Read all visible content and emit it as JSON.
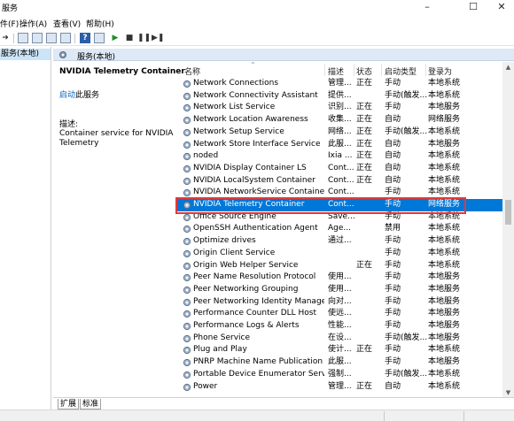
{
  "window": {
    "title": "服务"
  },
  "menu": [
    "件(F)",
    "操作(A)",
    "查看(V)",
    "帮助(H)"
  ],
  "tree": {
    "selected": "服务(本地)"
  },
  "band": {
    "label": "服务(本地)"
  },
  "details": {
    "service_name": "NVIDIA Telemetry Container",
    "start_link": "启动",
    "start_suffix": "此服务",
    "desc_label": "描述:",
    "desc_text": "Container service for NVIDIA Telemetry"
  },
  "columns": {
    "name": "名称",
    "desc": "描述",
    "status": "状态",
    "start": "启动类型",
    "logon": "登录为"
  },
  "rows": [
    {
      "name": "Network Connections",
      "desc": "管理...",
      "status": "正在",
      "start": "手动",
      "logon": "本地系统"
    },
    {
      "name": "Network Connectivity Assistant",
      "desc": "提供...",
      "status": "",
      "start": "手动(触发...",
      "logon": "本地系统"
    },
    {
      "name": "Network List Service",
      "desc": "识别...",
      "status": "正在",
      "start": "手动",
      "logon": "本地服务"
    },
    {
      "name": "Network Location Awareness",
      "desc": "收集...",
      "status": "正在",
      "start": "自动",
      "logon": "网络服务"
    },
    {
      "name": "Network Setup Service",
      "desc": "网络...",
      "status": "正在",
      "start": "手动(触发...",
      "logon": "本地系统"
    },
    {
      "name": "Network Store Interface Service",
      "desc": "此服...",
      "status": "正在",
      "start": "自动",
      "logon": "本地服务"
    },
    {
      "name": "noded",
      "desc": "Ixia ...",
      "status": "正在",
      "start": "自动",
      "logon": "本地系统"
    },
    {
      "name": "NVIDIA Display Container LS",
      "desc": "Cont...",
      "status": "正在",
      "start": "自动",
      "logon": "本地系统"
    },
    {
      "name": "NVIDIA LocalSystem Container",
      "desc": "Cont...",
      "status": "正在",
      "start": "自动",
      "logon": "本地系统"
    },
    {
      "name": "NVIDIA NetworkService Container",
      "desc": "Cont...",
      "status": "",
      "start": "手动",
      "logon": "本地系统"
    },
    {
      "name": "NVIDIA Telemetry Container",
      "desc": "Cont...",
      "status": "",
      "start": "手动",
      "logon": "网络服务"
    },
    {
      "name": "Office  Source Engine",
      "desc": "Save...",
      "status": "",
      "start": "手动",
      "logon": "本地系统"
    },
    {
      "name": "OpenSSH Authentication Agent",
      "desc": "Age...",
      "status": "",
      "start": "禁用",
      "logon": "本地系统"
    },
    {
      "name": "Optimize drives",
      "desc": "通过...",
      "status": "",
      "start": "手动",
      "logon": "本地系统"
    },
    {
      "name": "Origin Client Service",
      "desc": "",
      "status": "",
      "start": "手动",
      "logon": "本地系统"
    },
    {
      "name": "Origin Web Helper Service",
      "desc": "",
      "status": "正在",
      "start": "手动",
      "logon": "本地系统"
    },
    {
      "name": "Peer Name Resolution Protocol",
      "desc": "使用...",
      "status": "",
      "start": "手动",
      "logon": "本地服务"
    },
    {
      "name": "Peer Networking Grouping",
      "desc": "使用...",
      "status": "",
      "start": "手动",
      "logon": "本地服务"
    },
    {
      "name": "Peer Networking Identity Manager",
      "desc": "向对...",
      "status": "",
      "start": "手动",
      "logon": "本地服务"
    },
    {
      "name": "Performance Counter DLL Host",
      "desc": "使远...",
      "status": "",
      "start": "手动",
      "logon": "本地服务"
    },
    {
      "name": "Performance Logs & Alerts",
      "desc": "性能...",
      "status": "",
      "start": "手动",
      "logon": "本地服务"
    },
    {
      "name": "Phone Service",
      "desc": "在设...",
      "status": "",
      "start": "手动(触发...",
      "logon": "本地服务"
    },
    {
      "name": "Plug and Play",
      "desc": "使计...",
      "status": "正在",
      "start": "手动",
      "logon": "本地系统"
    },
    {
      "name": "PNRP Machine Name Publication Ser...",
      "desc": "此服...",
      "status": "",
      "start": "手动",
      "logon": "本地服务"
    },
    {
      "name": "Portable Device Enumerator Service",
      "desc": "强制...",
      "status": "",
      "start": "手动(触发...",
      "logon": "本地系统"
    },
    {
      "name": "Power",
      "desc": "管理...",
      "status": "正在",
      "start": "自动",
      "logon": "本地系统"
    }
  ],
  "selected_index": 10,
  "tabs": [
    "扩展",
    "标准"
  ],
  "accent": "#0078d7",
  "highlight_border": "#e03a3a"
}
